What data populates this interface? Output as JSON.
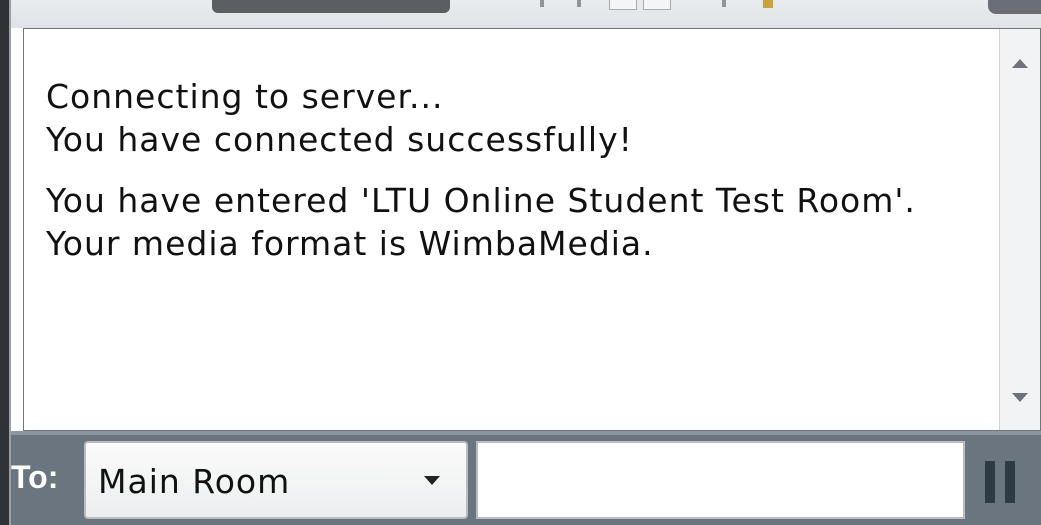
{
  "chat": {
    "messages": [
      "Connecting to server...",
      "You have connected successfully!",
      "You have entered 'LTU Online Student Test Room'.",
      "Your media format is WimbaMedia."
    ]
  },
  "input_bar": {
    "to_label": "To:",
    "recipient_selected": "Main Room",
    "message_value": ""
  },
  "icons": {
    "scroll_up": "chevron-up-icon",
    "scroll_down": "chevron-down-icon",
    "dropdown": "caret-down-icon",
    "pause": "pause-icon"
  },
  "colors": {
    "input_bar_bg": "#6b7580",
    "pause_icon": "#2e3a44"
  }
}
